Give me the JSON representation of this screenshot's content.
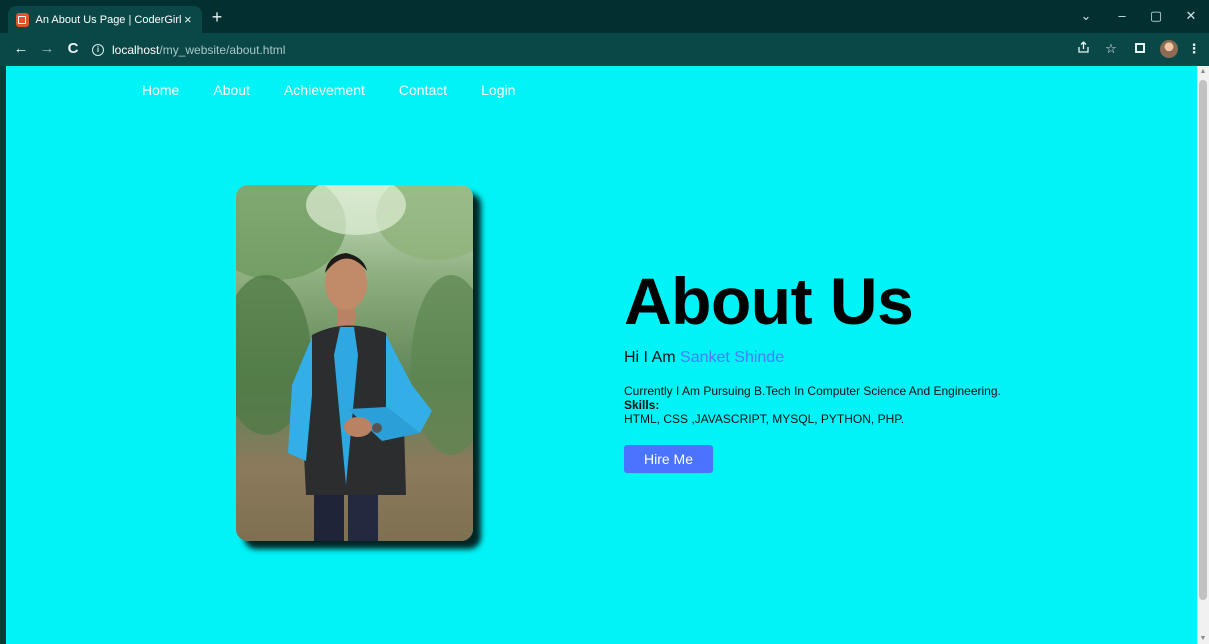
{
  "browser": {
    "tab_title": "An About Us Page | CoderGirl",
    "tab_close": "×",
    "new_tab": "+",
    "url_host": "localhost",
    "url_path": "/my_website/about.html",
    "window_controls": [
      "⌄",
      "–",
      "▢",
      "✕"
    ],
    "nav": {
      "back": "←",
      "forward": "→",
      "reload": "C"
    },
    "toolbar_icons": [
      "share-icon",
      "star-icon",
      "side-panel-icon",
      "profile-avatar",
      "menu-icon"
    ]
  },
  "page": {
    "background_color": "#00f3f6",
    "nav_links": [
      "Home",
      "About",
      "Achievement",
      "Contact",
      "Login"
    ],
    "title": "About Us",
    "greeting_prefix": "Hi I Am ",
    "name": "Sanket Shinde",
    "bio_line": "Currently I Am Pursuing B.Tech In Computer Science And Engineering.",
    "skills_label": "Skills:",
    "skills": "HTML, CSS ,JAVASCRIPT, MYSQL, PYTHON, PHP.",
    "hire_button": "Hire Me",
    "accent_color": "#4a73ff"
  }
}
